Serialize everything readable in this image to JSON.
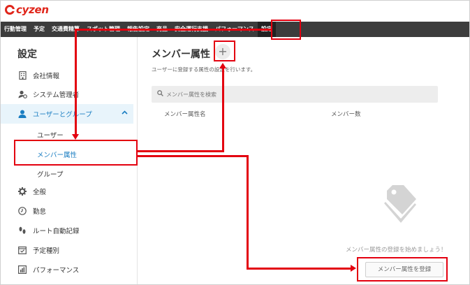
{
  "app": {
    "logo_text": "cyzen"
  },
  "topnav": {
    "items": [
      "行動管理",
      "予定",
      "交通費精算",
      "スポット管理",
      "報告設定",
      "商品",
      "安全運行支援",
      "パフォーマンス",
      "設定"
    ]
  },
  "sidebar": {
    "title": "設定",
    "items": [
      {
        "label": "会社情報",
        "icon": "building-icon"
      },
      {
        "label": "システム管理者",
        "icon": "admin-user-icon"
      },
      {
        "label": "ユーザーとグループ",
        "icon": "user-icon"
      },
      {
        "label": "全般",
        "icon": "gear-icon"
      },
      {
        "label": "勤怠",
        "icon": "clock-icon"
      },
      {
        "label": "ルート自動記録",
        "icon": "footprints-icon"
      },
      {
        "label": "予定種別",
        "icon": "calendar-check-icon"
      },
      {
        "label": "パフォーマンス",
        "icon": "bar-chart-icon"
      }
    ],
    "sub_items": [
      "ユーザー",
      "メンバー属性",
      "グループ"
    ]
  },
  "main": {
    "title": "メンバー属性",
    "add_label": "+",
    "description": "ユーザーに登録する属性の設定を行います。",
    "search_placeholder": "メンバー属性を検索",
    "columns": [
      "メンバー属性名",
      "メンバー数"
    ],
    "empty_text": "メンバー属性の登録を始めましょう！",
    "register_button": "メンバー属性を登録"
  },
  "colors": {
    "accent": "#1b7ec2",
    "brand": "#e0261b",
    "annotation": "#e3000f",
    "nav_bg": "#3c3c3c"
  }
}
